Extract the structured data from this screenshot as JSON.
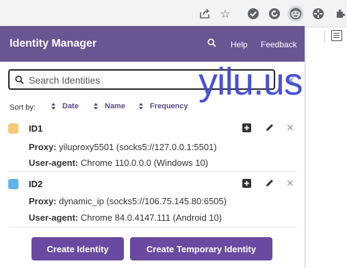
{
  "popup": {
    "title": "Identity Manager",
    "links": {
      "help": "Help",
      "feedback": "Feedback"
    },
    "search": {
      "placeholder": "Search Identities",
      "value": ""
    },
    "sort": {
      "label": "Sort by:",
      "options": [
        "Date",
        "Name",
        "Frequency"
      ]
    },
    "identities": [
      {
        "name": "ID1",
        "color": "#f9c978",
        "proxy_label": "Proxy:",
        "proxy_value": "yiluproxy5501 (socks5://127.0.0.1:5501)",
        "ua_label": "User-agent:",
        "ua_value": "Chrome 110.0.0.0 (Windows 10)"
      },
      {
        "name": "ID2",
        "color": "#5cb5e4",
        "proxy_label": "Proxy:",
        "proxy_value": "dynamic_ip (socks5://106.75.145.80:6505)",
        "ua_label": "User-agent:",
        "ua_value": "Chrome 84.0.4147.111 (Android 10)"
      }
    ],
    "buttons": {
      "create": "Create Identity",
      "create_temp": "Create Temporary Identity"
    }
  },
  "watermark": "yilu.us",
  "colors": {
    "header": "#6a5593",
    "accent": "#6a4aa0",
    "watermark": "#3f48d8"
  }
}
